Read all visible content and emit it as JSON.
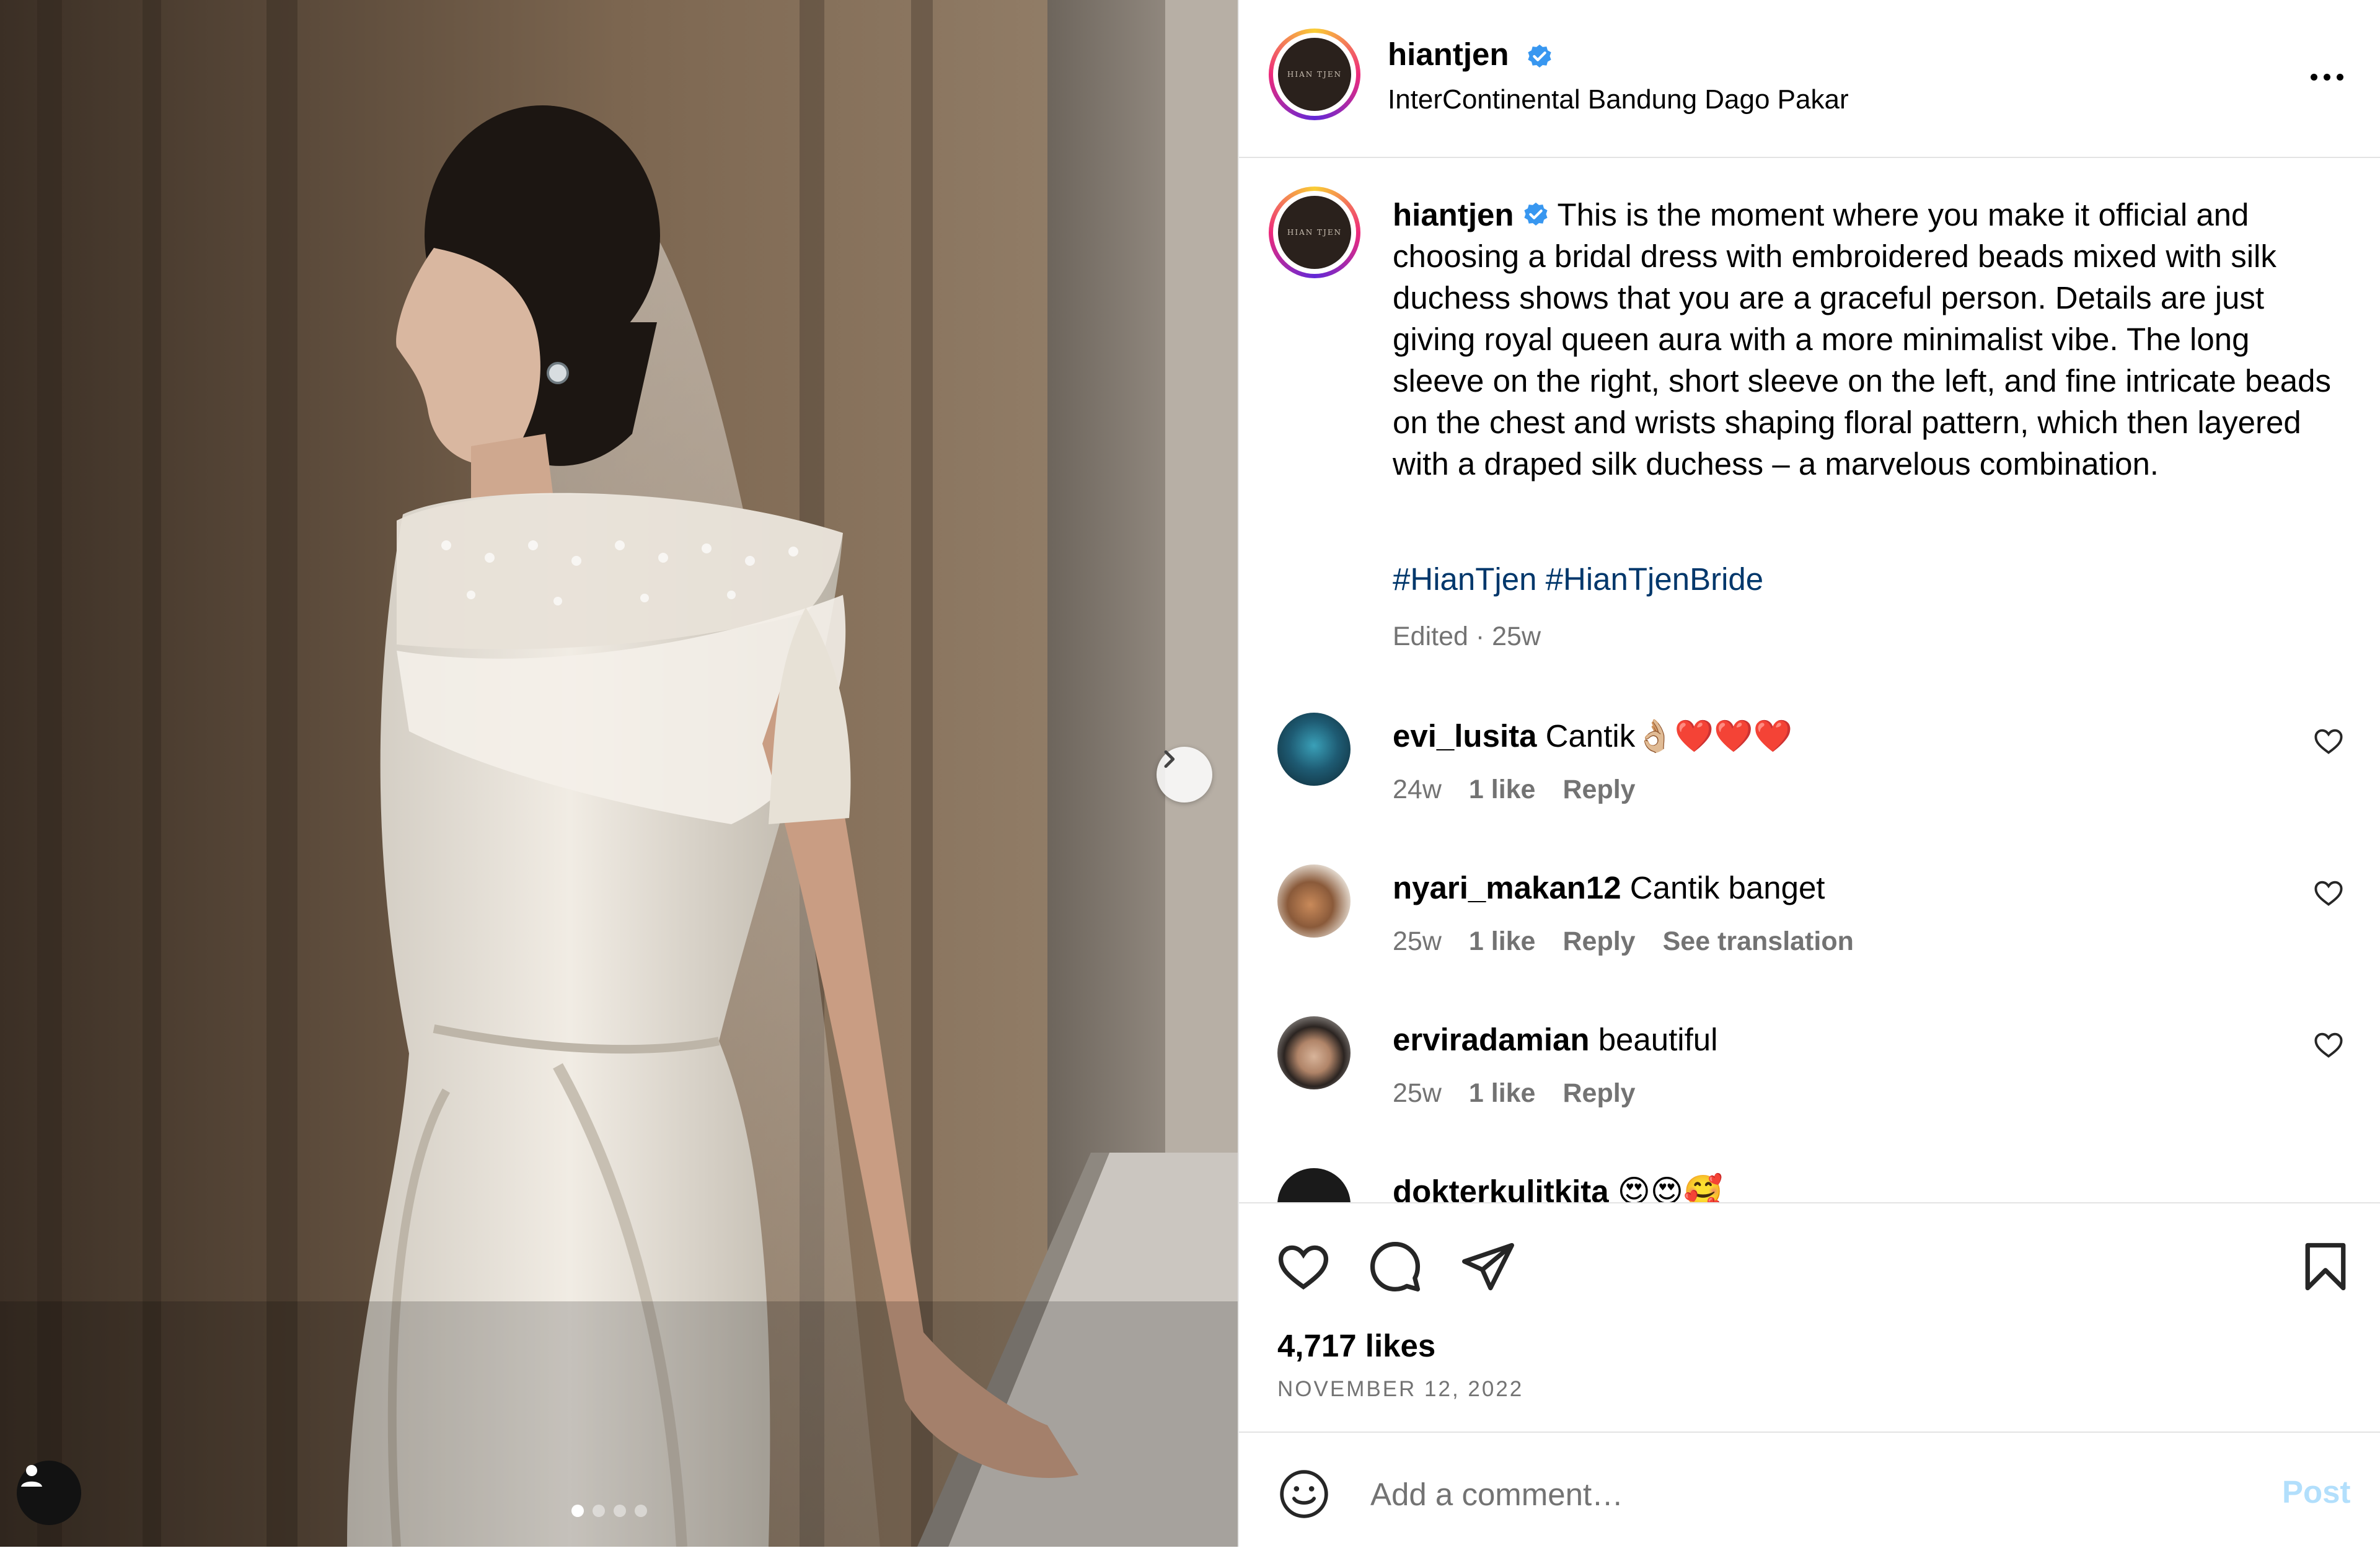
{
  "post": {
    "username": "hiantjen",
    "avatar_text": "HIAN TJEN",
    "location": "InterContinental Bandung Dago Pakar",
    "caption": "This is the moment where you make it official and choosing a bridal dress with embroidered beads mixed with silk duchess shows that you are a graceful person. Details are just giving royal queen aura with a more minimalist vibe. The long sleeve on the right, short sleeve on the left, and fine intricate beads on the chest and wrists shaping floral pattern, which then layered with a draped silk duchess – a marvelous combination.",
    "hashtags": [
      "#HianTjen",
      "#HianTjenBride"
    ],
    "edited": "Edited · 25w",
    "likes": "4,717 likes",
    "date": "NOVEMBER 12, 2022",
    "carousel_total": 4,
    "carousel_index": 1
  },
  "comments": [
    {
      "username": "evi_lusita",
      "text": "Cantik👌🏼❤️❤️❤️",
      "age": "24w",
      "likes": "1 like",
      "reply": "Reply",
      "translation": ""
    },
    {
      "username": "nyari_makan12",
      "text": "Cantik banget",
      "age": "25w",
      "likes": "1 like",
      "reply": "Reply",
      "translation": "See translation"
    },
    {
      "username": "erviradamian",
      "text": "beautiful",
      "age": "25w",
      "likes": "1 like",
      "reply": "Reply",
      "translation": ""
    },
    {
      "username": "dokterkulitkita",
      "text": "😍😍🥰",
      "age": "",
      "likes": "",
      "reply": "",
      "translation": ""
    }
  ],
  "add_comment": {
    "placeholder": "Add a comment…",
    "post_label": "Post"
  },
  "icons": {
    "verified": "verified-badge-icon",
    "more": "more-options-icon",
    "next": "chevron-right-icon",
    "tag": "user-tag-icon",
    "like": "heart-icon",
    "comment": "comment-bubble-icon",
    "share": "paper-plane-icon",
    "save": "bookmark-icon",
    "emoji": "emoji-smile-icon"
  },
  "colors": {
    "link": "#00376b",
    "muted": "#737373",
    "post_disabled": "#b2dffc",
    "verified": "#3897f0"
  }
}
